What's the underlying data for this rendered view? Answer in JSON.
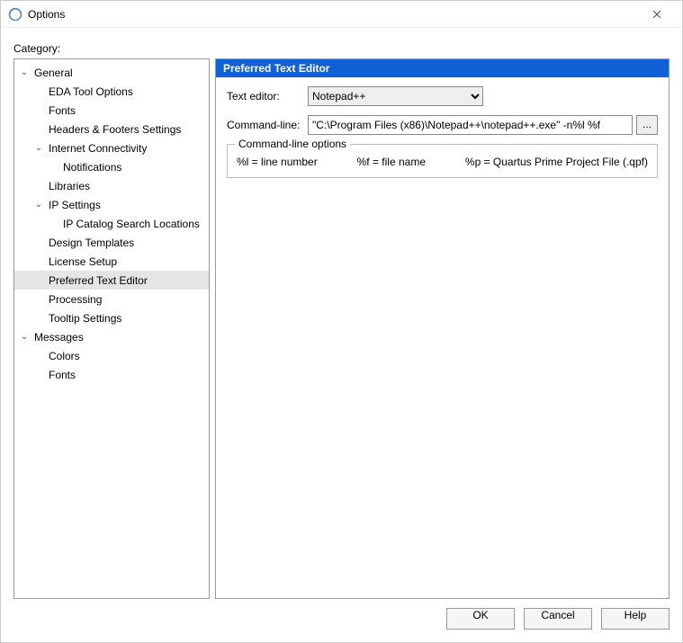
{
  "window": {
    "title": "Options"
  },
  "category_label": "Category:",
  "tree": {
    "items": [
      {
        "label": "General",
        "indent": 0,
        "expand": "open",
        "selected": false
      },
      {
        "label": "EDA Tool Options",
        "indent": 1,
        "expand": "none",
        "selected": false
      },
      {
        "label": "Fonts",
        "indent": 1,
        "expand": "none",
        "selected": false
      },
      {
        "label": "Headers & Footers Settings",
        "indent": 1,
        "expand": "none",
        "selected": false
      },
      {
        "label": "Internet Connectivity",
        "indent": 1,
        "expand": "open",
        "selected": false
      },
      {
        "label": "Notifications",
        "indent": 2,
        "expand": "none",
        "selected": false
      },
      {
        "label": "Libraries",
        "indent": 1,
        "expand": "none",
        "selected": false
      },
      {
        "label": "IP Settings",
        "indent": 1,
        "expand": "open",
        "selected": false
      },
      {
        "label": "IP Catalog Search Locations",
        "indent": 2,
        "expand": "none",
        "selected": false
      },
      {
        "label": "Design Templates",
        "indent": 1,
        "expand": "none",
        "selected": false
      },
      {
        "label": "License Setup",
        "indent": 1,
        "expand": "none",
        "selected": false
      },
      {
        "label": "Preferred Text Editor",
        "indent": 1,
        "expand": "none",
        "selected": true
      },
      {
        "label": "Processing",
        "indent": 1,
        "expand": "none",
        "selected": false
      },
      {
        "label": "Tooltip Settings",
        "indent": 1,
        "expand": "none",
        "selected": false
      },
      {
        "label": "Messages",
        "indent": 0,
        "expand": "open",
        "selected": false
      },
      {
        "label": "Colors",
        "indent": 1,
        "expand": "none",
        "selected": false
      },
      {
        "label": "Fonts",
        "indent": 1,
        "expand": "none",
        "selected": false
      }
    ]
  },
  "panel": {
    "header": "Preferred Text Editor",
    "text_editor_label": "Text editor:",
    "text_editor_value": "Notepad++",
    "command_line_label": "Command-line:",
    "command_line_value": "\"C:\\Program Files (x86)\\Notepad++\\notepad++.exe\" -n%l %f",
    "browse_label": "...",
    "options_legend": "Command-line options",
    "opt_l": "%l = line number",
    "opt_f": "%f = file name",
    "opt_p": "%p = Quartus Prime Project File (.qpf)"
  },
  "buttons": {
    "ok": "OK",
    "cancel": "Cancel",
    "help": "Help"
  }
}
